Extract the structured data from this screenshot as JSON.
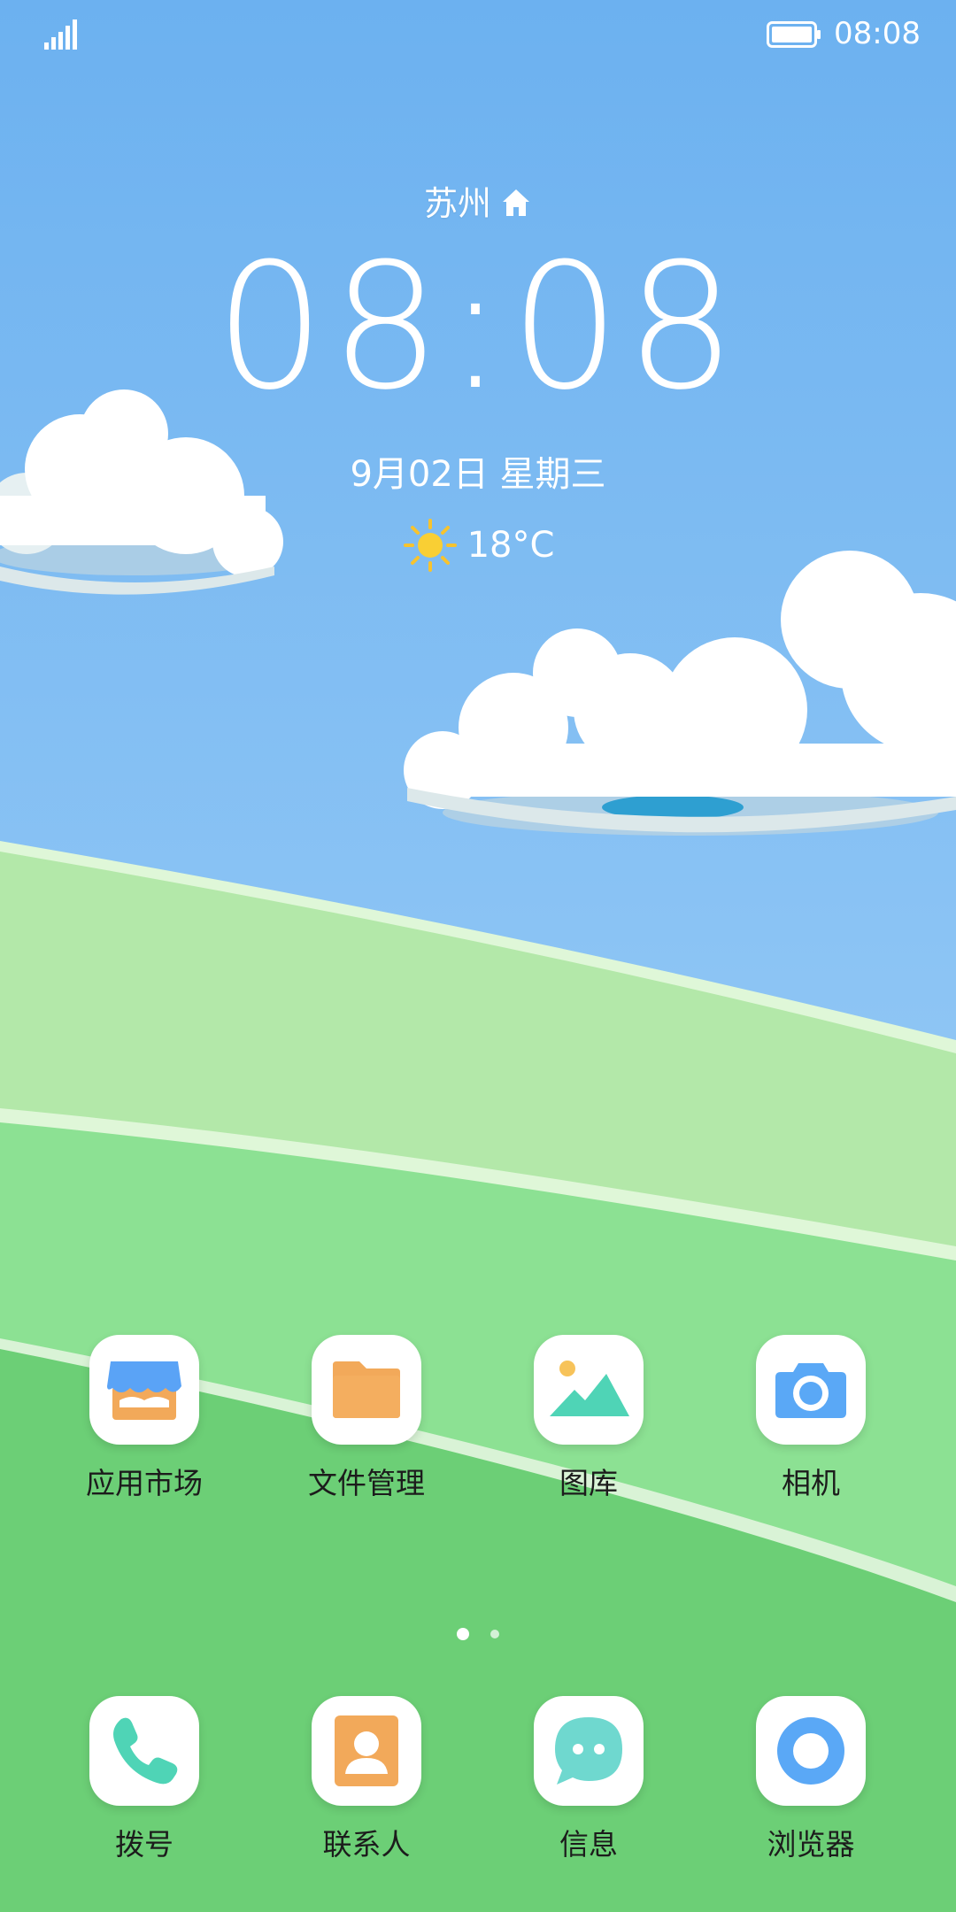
{
  "status_bar": {
    "time": "08:08"
  },
  "clock_widget": {
    "city": "苏州",
    "time": "08:08",
    "date": "9月02日 星期三",
    "temperature": "18°C"
  },
  "apps": [
    {
      "label": "应用市场",
      "icon": "app-market-icon"
    },
    {
      "label": "文件管理",
      "icon": "folder-icon"
    },
    {
      "label": "图库",
      "icon": "gallery-icon"
    },
    {
      "label": "相机",
      "icon": "camera-icon"
    }
  ],
  "dock": [
    {
      "label": "拨号",
      "icon": "phone-icon"
    },
    {
      "label": "联系人",
      "icon": "contacts-icon"
    },
    {
      "label": "信息",
      "icon": "messages-icon"
    },
    {
      "label": "浏览器",
      "icon": "browser-icon"
    }
  ],
  "colors": {
    "sky_top": "#6db0ef",
    "sky_bottom": "#a7d4f7",
    "hill_light": "#b3e8a9",
    "hill_mid": "#8be094",
    "hill_dark": "#6ccf76",
    "accent_blue": "#5aa8f6",
    "accent_orange": "#f2a95a",
    "accent_teal": "#4fd4b6"
  }
}
